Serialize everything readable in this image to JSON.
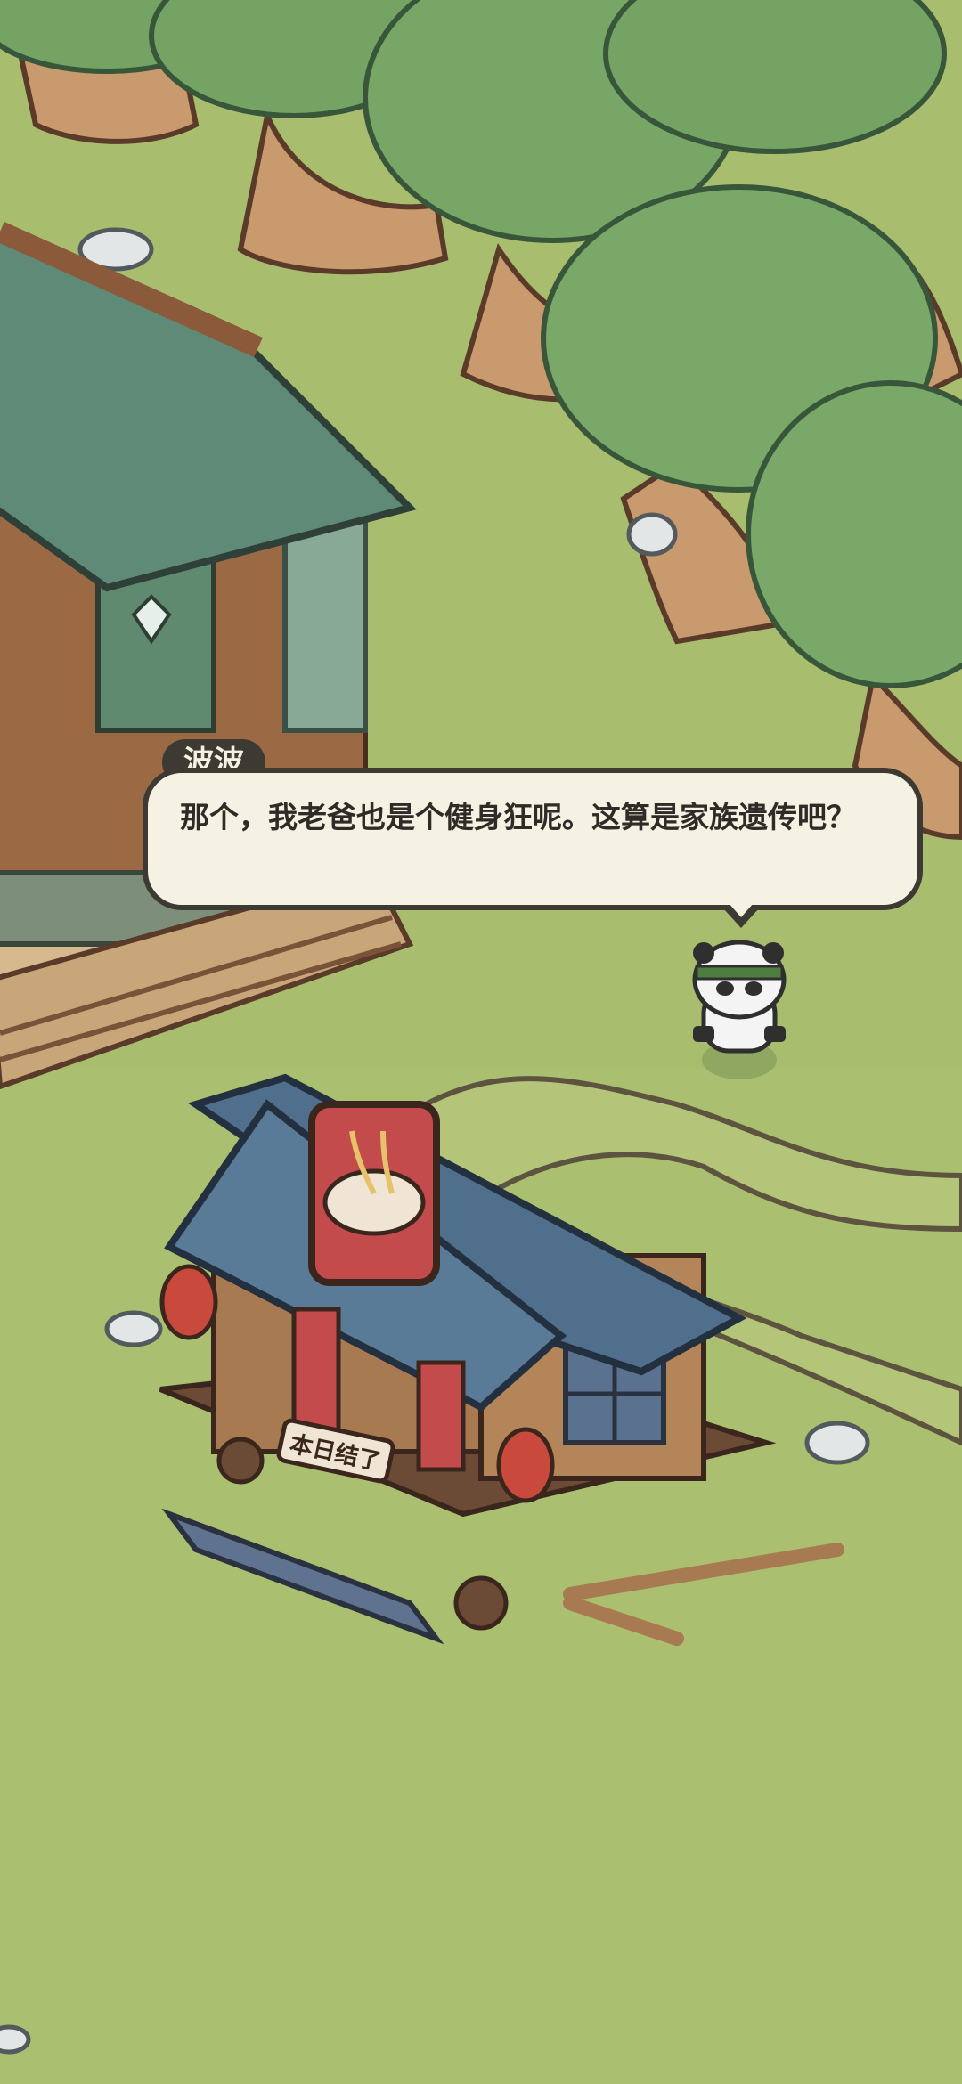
{
  "dialog": {
    "speaker": "波波",
    "text": "那个，我老爸也是个健身狂呢。这算是家族遗传吧？"
  },
  "shop": {
    "sign_text": "本日结了"
  },
  "colors": {
    "grass": "#a8bd6e",
    "tree_leaf": "#6e9f5e",
    "trunk": "#c99a6e",
    "roof_green": "#5f8a78",
    "roof_blue": "#4f6f8c",
    "wood": "#8a5a3a",
    "dialog_bg": "#f5f1e3",
    "dialog_border": "#3d3a33"
  },
  "characters": [
    {
      "name": "panda-character",
      "icon": "panda-with-headband-icon"
    }
  ]
}
